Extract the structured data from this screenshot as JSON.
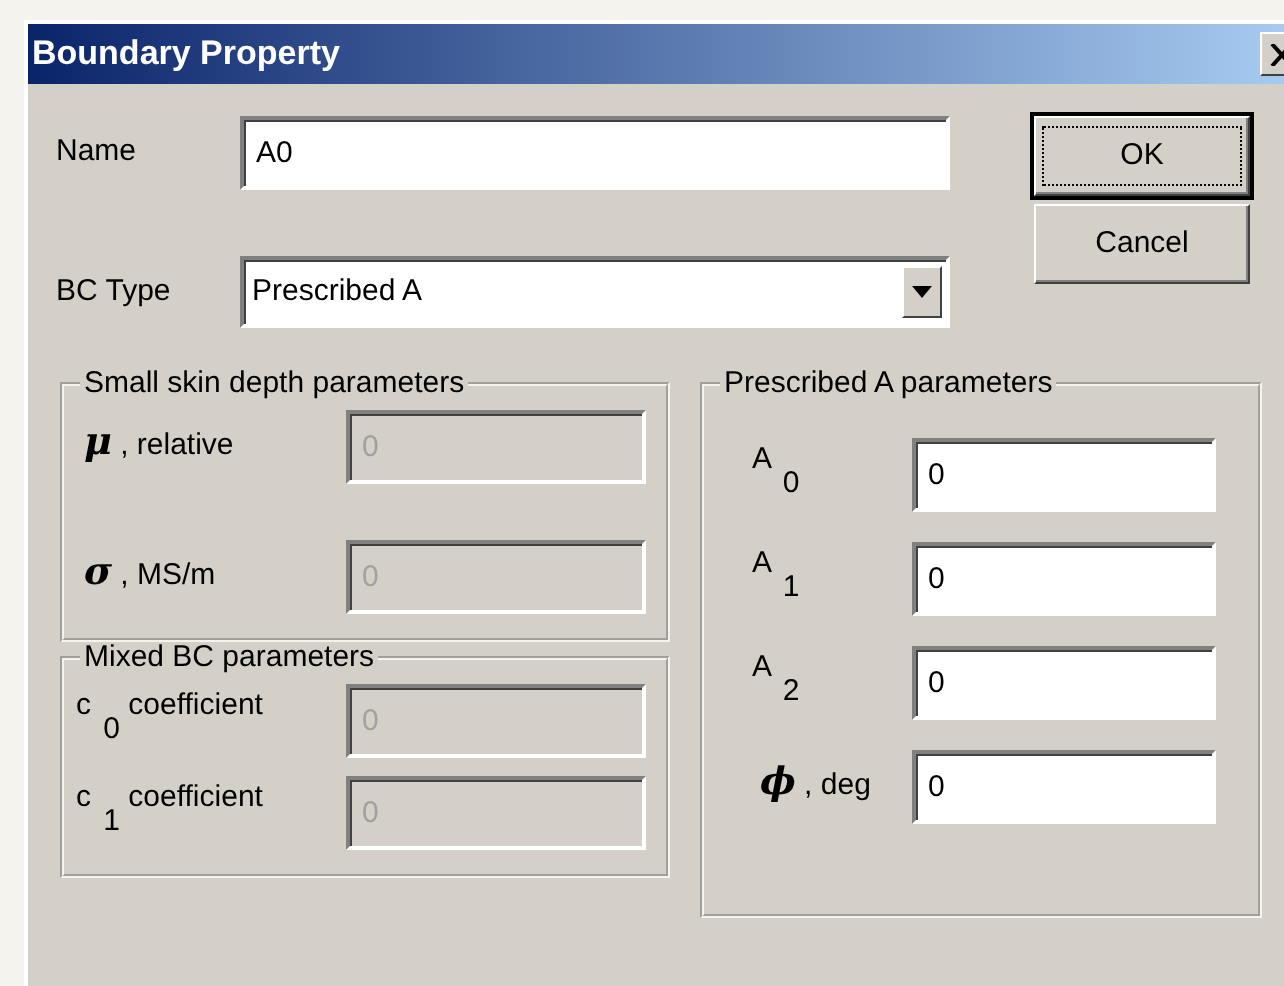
{
  "window": {
    "title": "Boundary Property"
  },
  "name_field": {
    "label": "Name",
    "value": "A0"
  },
  "bc_type": {
    "label": "BC Type",
    "value": "Prescribed A"
  },
  "buttons": [
    {
      "label": "OK",
      "default": true
    },
    {
      "label": "Cancel",
      "default": false
    }
  ],
  "left_groups": [
    {
      "title": "Small skin depth parameters",
      "fields": [
        {
          "label": "**μ** , relative",
          "value": "0",
          "disabled": true
        },
        {
          "label": "**σ** , MS/m",
          "value": "0",
          "disabled": true
        }
      ]
    },
    {
      "title": "Mixed BC parameters",
      "fields": [
        {
          "label": "c $_{0}$ coefficient",
          "value": "0",
          "disabled": true
        },
        {
          "label": "c $_{1}$ coefficient",
          "value": "0",
          "disabled": true
        }
      ]
    }
  ],
  "right_groups": [
    {
      "title": "Prescribed A parameters",
      "fields": [
        {
          "label": "A $_{0}$",
          "value": "0",
          "disabled": false
        },
        {
          "label": "A $_{1}$",
          "value": "0",
          "disabled": false
        },
        {
          "label": "A $_{2}$",
          "value": "0",
          "disabled": false
        },
        {
          "label": "**ϕ** , deg",
          "value": "0",
          "disabled": false
        }
      ]
    }
  ]
}
